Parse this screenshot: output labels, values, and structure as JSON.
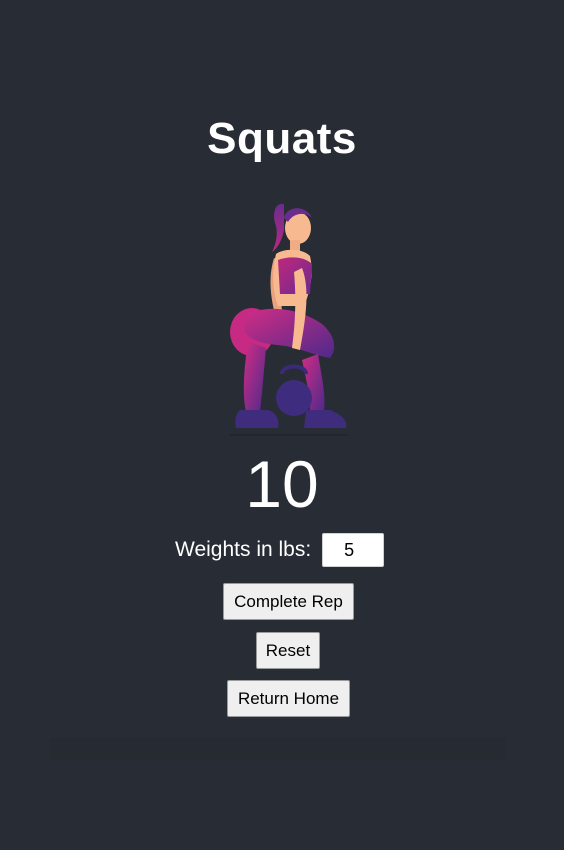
{
  "exercise": {
    "title": "Squats",
    "illustration_icon": "woman-kettlebell-squat-illustration"
  },
  "counter": {
    "reps": "10"
  },
  "weights": {
    "label": "Weights in lbs:",
    "value": "5"
  },
  "buttons": {
    "complete_rep": "Complete Rep",
    "reset": "Reset",
    "return_home": "Return Home"
  },
  "colors": {
    "background": "#282c34",
    "text": "#ffffff",
    "illustration_pink": "#c4287f",
    "illustration_purple": "#5a2c8c",
    "illustration_skin": "#f7b98f"
  }
}
